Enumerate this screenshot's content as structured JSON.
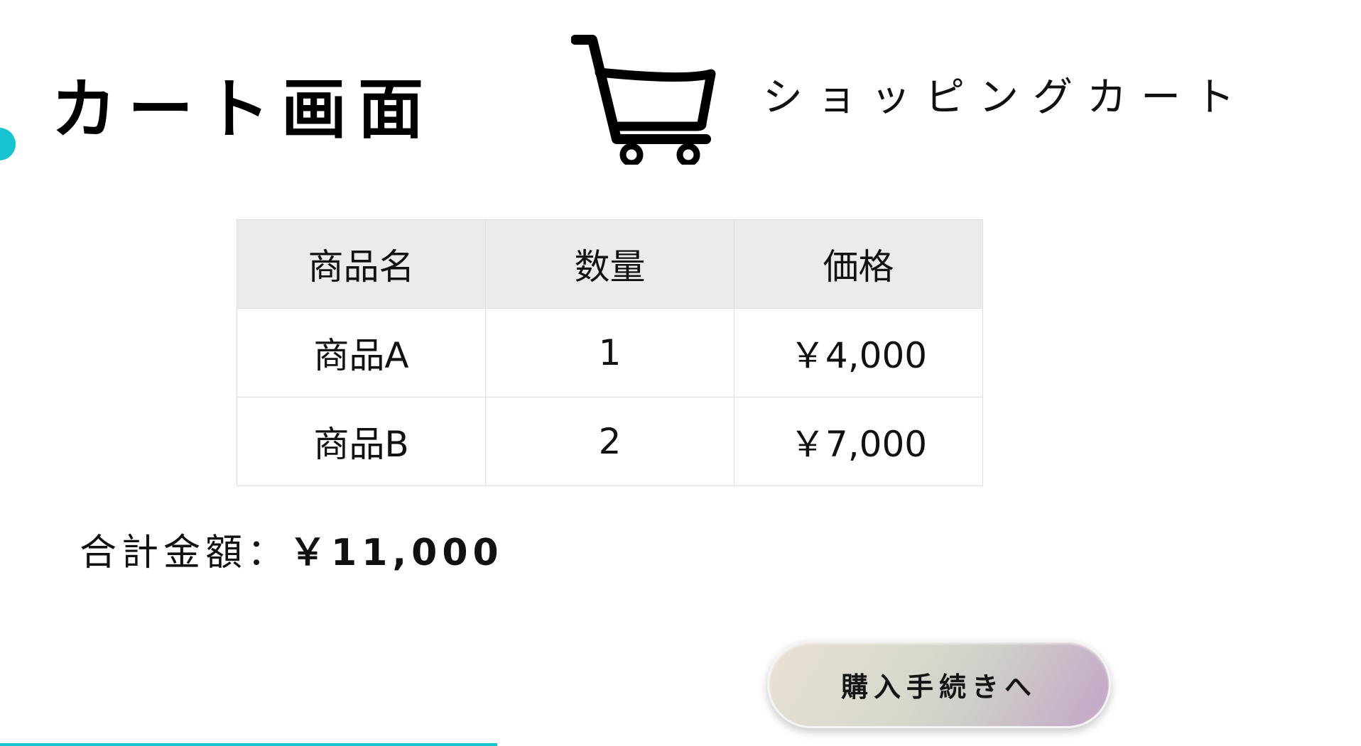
{
  "page": {
    "title": "カート画面"
  },
  "header": {
    "cart_icon": "shopping-cart-icon",
    "cart_heading": "ショッピングカート"
  },
  "cart_table": {
    "columns": [
      "商品名",
      "数量",
      "価格"
    ],
    "rows": [
      {
        "name": "商品A",
        "quantity": "1",
        "price": "￥4,000"
      },
      {
        "name": "商品B",
        "quantity": "2",
        "price": "￥7,000"
      }
    ]
  },
  "summary": {
    "total_label": "合計金額：",
    "total_value": "￥11,000"
  },
  "checkout": {
    "label": "購入手続きへ"
  },
  "colors": {
    "accent": "#15c4cf",
    "table_header_bg": "#ebebeb",
    "table_border": "#dedede",
    "button_gradient_start": "#e9e0d4",
    "button_gradient_end": "#c3a5c7"
  }
}
